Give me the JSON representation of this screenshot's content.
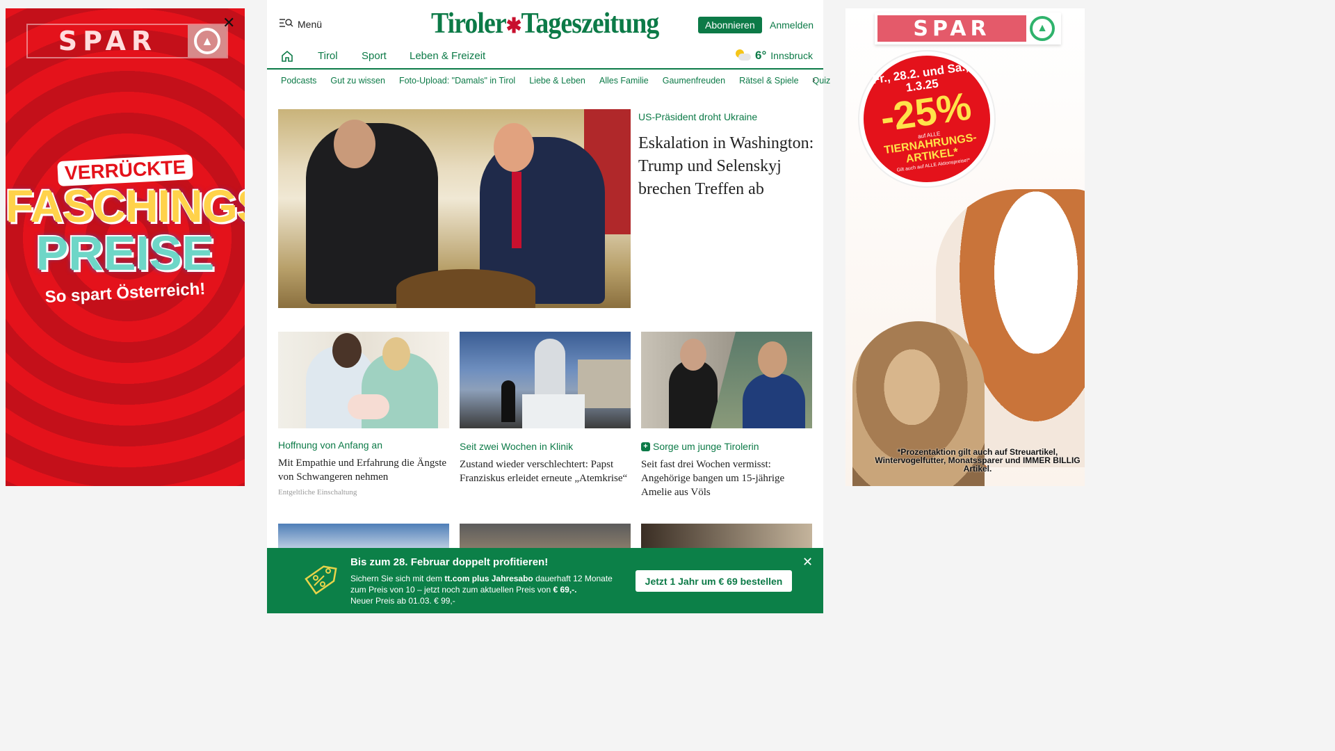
{
  "left_ad": {
    "brand": "SPAR",
    "close_label": "✕",
    "headline_top": "VERRÜCKTE",
    "headline_mid": "FASCHINGS",
    "headline_bottom": "PREISE",
    "tagline": "So spart Österreich!"
  },
  "right_ad": {
    "brand": "SPAR",
    "date": "Fr., 28.2. und Sa., 1.3.25",
    "discount": "-25%",
    "auf_alle": "auf ALLE",
    "articles": "TIERNAHRUNGS-ARTIKEL*",
    "small": "Gilt auch auf ALLE Aktionspreise!*",
    "disclaimer": "*Prozentaktion gilt auch auf Streuartikel, Wintervogelfutter, Monatssparer und IMMER BILLIG Artikel."
  },
  "header": {
    "menu_label": "Menü",
    "brand_left": "Tiroler",
    "brand_right": "Tageszeitung",
    "subscribe_label": "Abonnieren",
    "login_label": "Anmelden"
  },
  "nav": {
    "items": [
      "Tirol",
      "Sport",
      "Leben & Freizeit"
    ],
    "weather_temp": "6°",
    "weather_city": "Innsbruck"
  },
  "subnav": {
    "items": [
      "Podcasts",
      "Gut zu wissen",
      "Foto-Upload: \"Damals\" in Tirol",
      "Liebe & Leben",
      "Alles Familie",
      "Gaumenfreuden",
      "Rätsel & Spiele",
      "Quiz"
    ]
  },
  "hero": {
    "kicker": "US-Präsident droht Ukraine",
    "title": "Eskalation in Washington: Trump und Selenskyj brechen Treffen ab"
  },
  "cards": [
    {
      "kicker": "Hoffnung von Anfang an",
      "title": "Mit Empathie und Erfahrung die Ängste von Schwangeren nehmen",
      "note": "Entgeltliche Einschaltung"
    },
    {
      "kicker": "Seit zwei Wochen in Klinik",
      "title": "Zustand wieder verschlechtert: Papst Franziskus erleidet erneute „Atemkrise“"
    },
    {
      "kicker": "Sorge um junge Tirolerin",
      "title": "Seit fast drei Wochen vermisst: Angehörige bangen um 15-jährige Amelie aus Völs"
    }
  ],
  "promo": {
    "title": "Bis zum 28. Februar doppelt profitieren!",
    "text_1": "Sichern Sie sich mit dem ",
    "text_brand": "tt.com plus Jahresabo",
    "text_2": " dauerhaft 12 Monate zum Preis von 10 – jetzt noch zum aktuellen Preis von ",
    "text_price": "€ 69,-.",
    "text_3": "Neuer Preis ab 01.03. € 99,-",
    "button_label": "Jetzt 1 Jahr um € 69 bestellen",
    "close_label": "✕"
  },
  "colors": {
    "brand_green": "#0c7a47",
    "banner_green": "#0c8048",
    "spar_red": "#e4121b"
  },
  "icons": [
    "menu-search-icon",
    "home-icon",
    "weather-icon",
    "chevron-right-icon",
    "plus-icon",
    "tag-percent-icon",
    "close-icon"
  ]
}
